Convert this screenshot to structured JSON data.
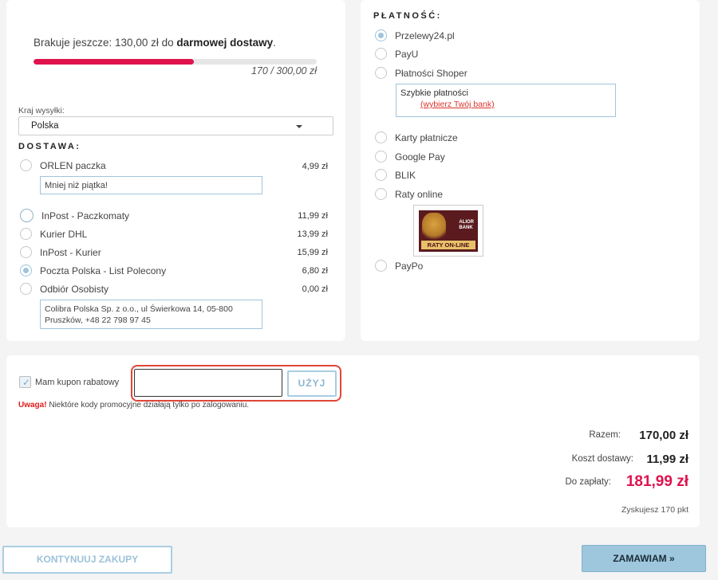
{
  "shipping_panel": {
    "free_shipping_prefix": "Brakuje jeszcze: 130,00 zł do ",
    "free_shipping_bold": "darmowej dostawy",
    "free_shipping_suffix": ".",
    "progress_value": 170,
    "progress_max": 300,
    "progress_text": "170 / 300,00 zł",
    "country_label": "Kraj wysyłki:",
    "country_value": "Polska",
    "delivery_title": "DOSTAWA:",
    "options": [
      {
        "label": "ORLEN paczka",
        "price": "4,99 zł",
        "selected": false,
        "note": "Mniej niż piątka!"
      },
      {
        "label": "InPost - Paczkomaty",
        "price": "11,99 zł",
        "selected": false
      },
      {
        "label": "Kurier DHL",
        "price": "13,99 zł",
        "selected": false
      },
      {
        "label": "InPost - Kurier",
        "price": "15,99 zł",
        "selected": false
      },
      {
        "label": "Poczta Polska - List Polecony",
        "price": "6,80 zł",
        "selected": true
      },
      {
        "label": "Odbiór Osobisty",
        "price": "0,00 zł",
        "selected": false,
        "note_line1": "Colibra Polska Sp. z o.o., ul Świerkowa 14, 05-800",
        "note_line2": "Pruszków, +48 22 798 97 45"
      }
    ]
  },
  "payment_panel": {
    "title": "PŁATNOŚĆ:",
    "options": [
      {
        "label": "Przelewy24.pl",
        "selected": true
      },
      {
        "label": "PayU",
        "selected": false
      },
      {
        "label": "Płatności Shoper",
        "selected": false
      },
      {
        "label": "Karty płatnicze",
        "selected": false
      },
      {
        "label": "Google Pay",
        "selected": false
      },
      {
        "label": "BLIK",
        "selected": false
      },
      {
        "label": "Raty online",
        "selected": false
      },
      {
        "label": "PayPo",
        "selected": false
      }
    ],
    "fast_payments_label": "Szybkie płatności",
    "choose_bank_link": "(wybierz Twój bank)",
    "alior_logo": {
      "line1": "ALIOR",
      "line2": "BANK",
      "raty": "RATY ON-LINE"
    }
  },
  "coupon": {
    "checkbox_label": "Mam kupon rabatowy",
    "checked": true,
    "input_value": "",
    "apply_label": "UŻYJ",
    "warning_bold": "Uwaga!",
    "warning_text": " Niektóre kody promocyjne działają tylko po zalogowaniu."
  },
  "summary": {
    "total_label": "Razem:",
    "total_value": "170,00 zł",
    "shipping_label": "Koszt dostawy:",
    "shipping_value": "11,99 zł",
    "to_pay_label": "Do zapłaty:",
    "to_pay_value": "181,99 zł",
    "points": "Zyskujesz 170 pkt"
  },
  "actions": {
    "continue_label": "KONTYNUUJ ZAKUPY",
    "order_label": "ZAMAWIAM »"
  },
  "colors": {
    "accent": "#e0124e",
    "button_blue": "#9ec7dd",
    "highlight": "#e24637"
  }
}
